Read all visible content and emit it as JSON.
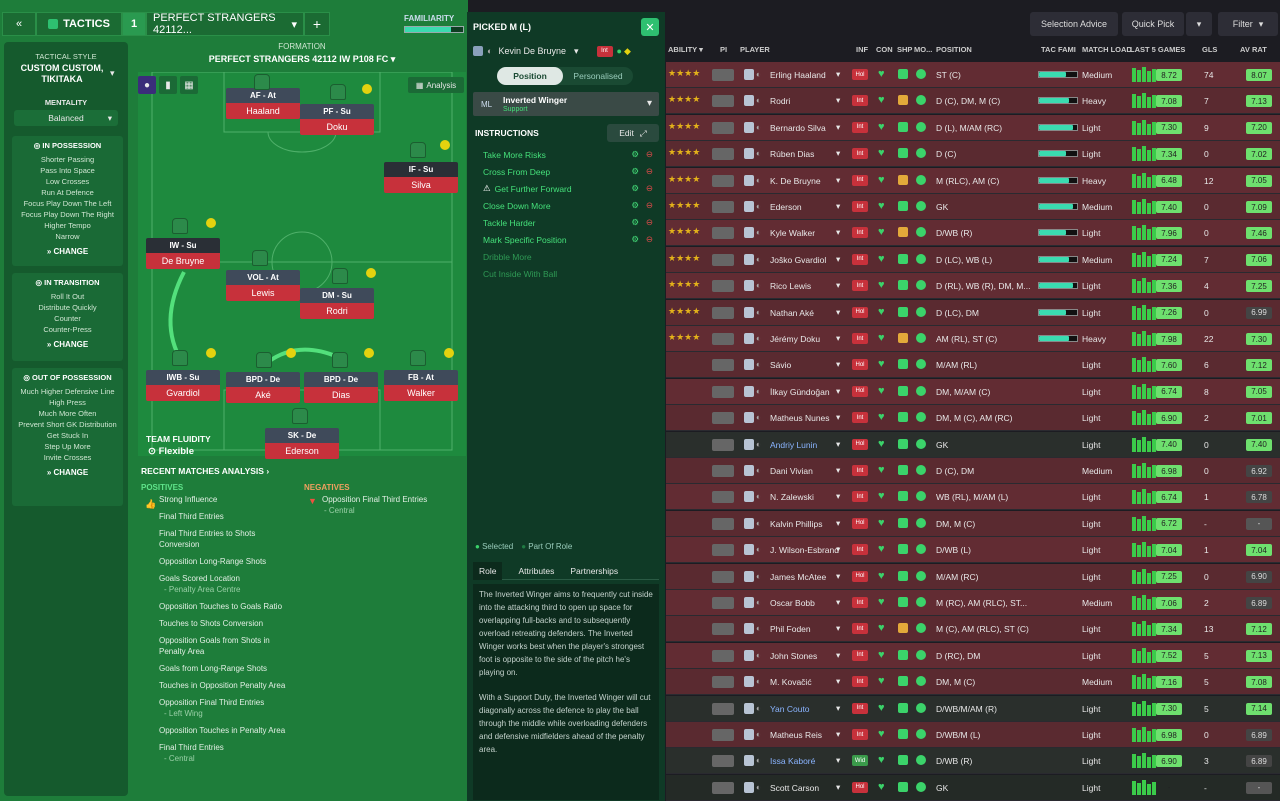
{
  "topbar": {
    "tactics": "TACTICS",
    "slot": "1",
    "name": "PERFECT STRANGERS 42112...",
    "familiarity": "FAMILIARITY"
  },
  "side": {
    "style_label": "TACTICAL STYLE",
    "style_value": "CUSTOM CUSTOM, TIKITAKA",
    "mentality_label": "MENTALITY",
    "mentality_value": "Balanced",
    "in_possession": {
      "title": "IN POSSESSION",
      "items": [
        "Shorter Passing",
        "Pass Into Space",
        "Low Crosses",
        "Run At Defence",
        "Focus Play Down The Left",
        "Focus Play Down The Right",
        "Higher Tempo",
        "Narrow"
      ]
    },
    "in_transition": {
      "title": "IN TRANSITION",
      "items": [
        "Roll It Out",
        "Distribute Quickly",
        "Counter",
        "Counter-Press"
      ]
    },
    "out_possession": {
      "title": "OUT OF POSSESSION",
      "items": [
        "Much Higher Defensive Line",
        "High Press",
        "Much More Often",
        "Prevent Short GK Distribution",
        "Get Stuck In",
        "Step Up More",
        "Invite Crosses"
      ]
    },
    "change": "CHANGE"
  },
  "formation": {
    "label": "FORMATION",
    "name": "PERFECT STRANGERS 42112 IW P108 FC",
    "analysis": "Analysis",
    "fluidity_label": "TEAM FLUIDITY",
    "fluidity_value": "Flexible"
  },
  "players_pitch": [
    {
      "role": "AF - At",
      "name": "Haaland"
    },
    {
      "role": "PF - Su",
      "name": "Doku"
    },
    {
      "role": "IF - Su",
      "name": "Silva"
    },
    {
      "role": "IW - Su",
      "name": "De Bruyne"
    },
    {
      "role": "VOL - At",
      "name": "Lewis"
    },
    {
      "role": "DM - Su",
      "name": "Rodri"
    },
    {
      "role": "IWB - Su",
      "name": "Gvardiol"
    },
    {
      "role": "BPD - De",
      "name": "Aké"
    },
    {
      "role": "BPD - De",
      "name": "Dias"
    },
    {
      "role": "FB - At",
      "name": "Walker"
    },
    {
      "role": "SK - De",
      "name": "Ederson"
    }
  ],
  "analysis": {
    "title": "RECENT MATCHES ANALYSIS",
    "pos_label": "POSITIVES",
    "neg_label": "NEGATIVES",
    "positives": [
      "Strong Influence",
      "Final Third Entries",
      "Final Third Entries to Shots Conversion",
      "Opposition Long-Range Shots",
      "Goals Scored Location",
      "- Penalty Area Centre",
      "Opposition Touches to Goals Ratio",
      "Touches to Shots Conversion",
      "Opposition Goals from Shots in Penalty Area",
      "Goals from Long-Range Shots",
      "Touches in Opposition Penalty Area",
      "Opposition Final Third Entries",
      "- Left Wing",
      "Opposition Touches in Penalty Area",
      "Final Third Entries",
      "- Central"
    ],
    "negatives": [
      "Opposition Final Third Entries",
      "- Central"
    ]
  },
  "picked": {
    "title": "PICKED M (L)",
    "player": "Kevin De Bruyne",
    "tab_position": "Position",
    "tab_personalised": "Personalised",
    "pos": "ML",
    "role": "Inverted Winger",
    "duty": "Support",
    "instructions_label": "INSTRUCTIONS",
    "edit": "Edit",
    "instructions": [
      "Take More Risks",
      "Cross From Deep",
      "Get Further Forward",
      "Close Down More",
      "Tackle Harder",
      "Mark Specific Position",
      "Dribble More",
      "Cut Inside With Ball"
    ],
    "legend_selected": "Selected",
    "legend_part": "Part Of Role",
    "tabs": [
      "Role",
      "Attributes",
      "Partnerships"
    ],
    "desc1": "The Inverted Winger aims to frequently cut inside into the attacking third to open up space for overlapping full-backs and to subsequently overload retreating defenders. The Inverted Winger works best when the player's strongest foot is opposite to the side of the pitch he's playing on.",
    "desc2": "With a Support Duty, the Inverted Winger will cut diagonally across the defence to play the ball through the middle while overloading defenders and defensive midfielders ahead of the penalty area."
  },
  "right": {
    "selection_advice": "Selection Advice",
    "quick_pick": "Quick Pick",
    "filter": "Filter",
    "headers": {
      "ability": "ABILITY",
      "pi": "PI",
      "player": "PLAYER",
      "inf": "INF",
      "con": "CON",
      "shp": "SHP",
      "mo": "MO...",
      "position": "POSITION",
      "tacfami": "TAC FAMI",
      "load": "MATCH LOAD",
      "last5": "LAST 5 GAMES",
      "gls": "GLS",
      "avrat": "AV RAT"
    },
    "rows": [
      {
        "name": "Erling Haaland",
        "badge": "Hol",
        "pos": "ST (C)",
        "load": "Medium",
        "l5": "8.72",
        "gls": "74",
        "av": "8.07"
      },
      {
        "name": "Rodri",
        "badge": "Int",
        "pos": "D (C), DM, M (C)",
        "load": "Heavy",
        "l5": "7.08",
        "gls": "7",
        "av": "7.13"
      },
      {
        "name": "Bernardo Silva",
        "badge": "Int",
        "pos": "D (L), M/AM (RC)",
        "load": "Light",
        "l5": "7.30",
        "gls": "9",
        "av": "7.20"
      },
      {
        "name": "Rúben Dias",
        "badge": "Int",
        "pos": "D (C)",
        "load": "Light",
        "l5": "7.34",
        "gls": "0",
        "av": "7.02"
      },
      {
        "name": "K. De Bruyne",
        "badge": "Int",
        "pos": "M (RLC), AM (C)",
        "load": "Heavy",
        "l5": "6.48",
        "gls": "12",
        "av": "7.05"
      },
      {
        "name": "Ederson",
        "badge": "Int",
        "pos": "GK",
        "load": "Medium",
        "l5": "7.40",
        "gls": "0",
        "av": "7.09"
      },
      {
        "name": "Kyle Walker",
        "badge": "Int",
        "pos": "D/WB (R)",
        "load": "Light",
        "l5": "7.96",
        "gls": "0",
        "av": "7.46"
      },
      {
        "name": "Joško Gvardiol",
        "badge": "Int",
        "pos": "D (LC), WB (L)",
        "load": "Medium",
        "l5": "7.24",
        "gls": "7",
        "av": "7.06"
      },
      {
        "name": "Rico Lewis",
        "badge": "Int",
        "pos": "D (RL), WB (R), DM, M...",
        "load": "Light",
        "l5": "7.36",
        "gls": "4",
        "av": "7.25"
      },
      {
        "name": "Nathan Aké",
        "badge": "Hol",
        "pos": "D (LC), DM",
        "load": "Light",
        "l5": "7.26",
        "gls": "0",
        "av": "6.99"
      },
      {
        "name": "Jérémy Doku",
        "badge": "Int",
        "pos": "AM (RL), ST (C)",
        "load": "Heavy",
        "l5": "7.98",
        "gls": "22",
        "av": "7.30"
      },
      {
        "name": "Sávio",
        "badge": "Hol",
        "pos": "M/AM (RL)",
        "load": "Light",
        "l5": "7.60",
        "gls": "6",
        "av": "7.12"
      },
      {
        "name": "İlkay Gündoğan",
        "badge": "Hol",
        "pos": "DM, M/AM (C)",
        "load": "Light",
        "l5": "6.74",
        "gls": "8",
        "av": "7.05"
      },
      {
        "name": "Matheus Nunes",
        "badge": "Int",
        "pos": "DM, M (C), AM (RC)",
        "load": "Light",
        "l5": "6.90",
        "gls": "2",
        "av": "7.01"
      },
      {
        "name": "Andriy Lunin",
        "badge": "Hol",
        "pos": "GK",
        "load": "Light",
        "l5": "7.40",
        "gls": "0",
        "av": "7.40"
      },
      {
        "name": "Dani Vivian",
        "badge": "Int",
        "pos": "D (C), DM",
        "load": "Medium",
        "l5": "6.98",
        "gls": "0",
        "av": "6.92"
      },
      {
        "name": "N. Zalewski",
        "badge": "Int",
        "pos": "WB (RL), M/AM (L)",
        "load": "Light",
        "l5": "6.74",
        "gls": "1",
        "av": "6.78"
      },
      {
        "name": "Kalvin Phillips",
        "badge": "Hol",
        "pos": "DM, M (C)",
        "load": "Light",
        "l5": "6.72",
        "gls": "-",
        "av": "-"
      },
      {
        "name": "J. Wilson-Esbrand",
        "badge": "Int",
        "pos": "D/WB (L)",
        "load": "Light",
        "l5": "7.04",
        "gls": "1",
        "av": "7.04"
      },
      {
        "name": "James McAtee",
        "badge": "Hol",
        "pos": "M/AM (RC)",
        "load": "Light",
        "l5": "7.25",
        "gls": "0",
        "av": "6.90"
      },
      {
        "name": "Oscar Bobb",
        "badge": "Int",
        "pos": "M (RC), AM (RLC), ST...",
        "load": "Medium",
        "l5": "7.06",
        "gls": "2",
        "av": "6.89"
      },
      {
        "name": "Phil Foden",
        "badge": "Int",
        "pos": "M (C), AM (RLC), ST (C)",
        "load": "Light",
        "l5": "7.34",
        "gls": "13",
        "av": "7.12"
      },
      {
        "name": "John Stones",
        "badge": "Int",
        "pos": "D (RC), DM",
        "load": "Light",
        "l5": "7.52",
        "gls": "5",
        "av": "7.13"
      },
      {
        "name": "M. Kovačić",
        "badge": "Int",
        "pos": "DM, M (C)",
        "load": "Medium",
        "l5": "7.16",
        "gls": "5",
        "av": "7.08"
      },
      {
        "name": "Yan Couto",
        "badge": "Int",
        "pos": "D/WB/M/AM (R)",
        "load": "Light",
        "l5": "7.30",
        "gls": "5",
        "av": "7.14"
      },
      {
        "name": "Matheus Reis",
        "badge": "Int",
        "pos": "D/WB/M (L)",
        "load": "Light",
        "l5": "6.98",
        "gls": "0",
        "av": "6.89"
      },
      {
        "name": "Issa Kaboré",
        "badge": "Wid",
        "pos": "D/WB (R)",
        "load": "Light",
        "l5": "6.90",
        "gls": "3",
        "av": "6.89"
      },
      {
        "name": "Scott Carson",
        "badge": "Hol",
        "pos": "GK",
        "load": "Light",
        "l5": "-",
        "gls": "-",
        "av": "-"
      }
    ]
  }
}
